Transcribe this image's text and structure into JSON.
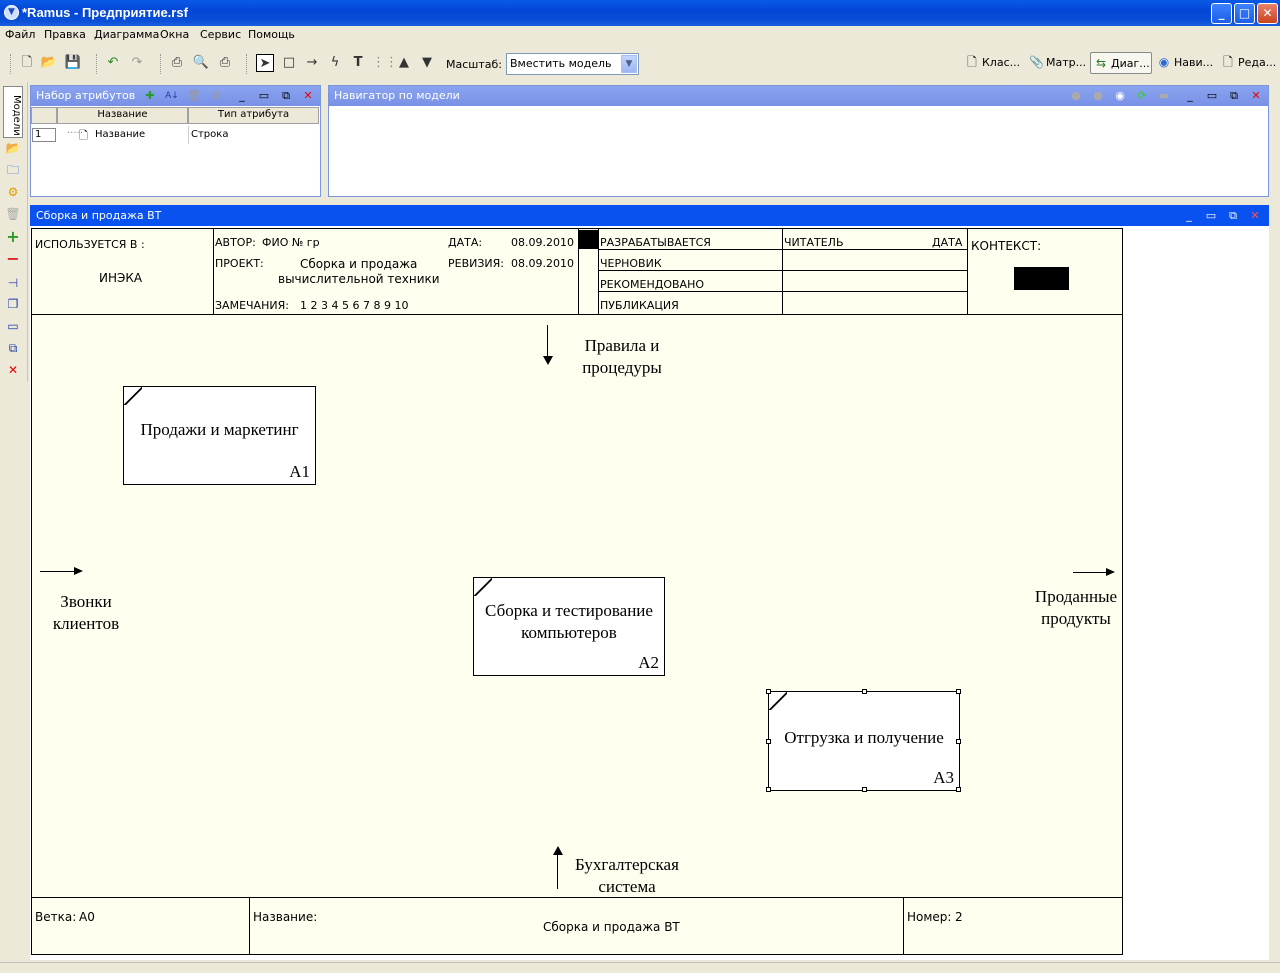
{
  "window": {
    "title": "*Ramus - Предприятие.rsf"
  },
  "menu": [
    "Файл",
    "Правка",
    "Диаграмма",
    "Окна",
    "Сервис",
    "Помощь"
  ],
  "toolbar": {
    "zoom_label": "Масштаб:",
    "zoom_value": "Вместить модель",
    "right_tabs": [
      {
        "label": "Клас...",
        "icon": "document-icon"
      },
      {
        "label": "Матр...",
        "icon": "paperclip-icon"
      },
      {
        "label": "Диаг...",
        "icon": "diagram-icon",
        "active": true
      },
      {
        "label": "Нави...",
        "icon": "globe-icon"
      },
      {
        "label": "Реда...",
        "icon": "page-icon"
      }
    ]
  },
  "sidebar": {
    "vertical_tab": "Модели"
  },
  "attributes_panel": {
    "title": "Набор атрибутов",
    "columns": [
      "Название",
      "Тип атрибута"
    ],
    "rows": [
      {
        "num": "1",
        "name": "Название",
        "type": "Строка"
      }
    ]
  },
  "navigator_panel": {
    "title": "Навигатор по модели"
  },
  "diagram": {
    "title": "Сборка и продажа ВТ",
    "header": {
      "used_in_label": "ИСПОЛЬЗУЕТСЯ В :",
      "used_in_value": "ИНЭКА",
      "author_label": "АВТОР:",
      "author_value": "ФИО № гр",
      "project_label": "ПРОЕКТ:",
      "project_line1": "Сборка и продажа",
      "project_line2": "вычислительной техники",
      "notes_label": "ЗАМЕЧАНИЯ:",
      "notes_value": "1 2 3 4 5 6 7 8 9 10",
      "date_label": "ДАТА:",
      "date_value": "08.09.2010",
      "revision_label": "РЕВИЗИЯ:",
      "revision_value": "08.09.2010",
      "statuses": [
        "РАЗРАБАТЫВАЕТСЯ",
        "ЧЕРНОВИК",
        "РЕКОМЕНДОВАНО",
        "ПУБЛИКАЦИЯ"
      ],
      "reader_label": "ЧИТАТЕЛЬ",
      "reader_date_label": "ДАТА",
      "context_label": "КОНТЕКСТ:"
    },
    "boxes": [
      {
        "label": "Продажи и маркетинг",
        "number": "A1"
      },
      {
        "label_line1": "Сборка и тестирование",
        "label_line2": "компьютеров",
        "number": "A2"
      },
      {
        "label": "Отгрузка и получение",
        "number": "A3"
      }
    ],
    "arrows": {
      "control_line1": "Правила и",
      "control_line2": "процедуры",
      "input_line1": "Звонки",
      "input_line2": "клиентов",
      "output_line1": "Проданные",
      "output_line2": "продукты",
      "mechanism_line1": "Бухгалтерская",
      "mechanism_line2": "система"
    },
    "footer": {
      "node_label": "Ветка:",
      "node_value": "A0",
      "name_label": "Название:",
      "name_value": "Сборка и продажа ВТ",
      "number_label": "Номер:",
      "number_value": "2"
    }
  }
}
